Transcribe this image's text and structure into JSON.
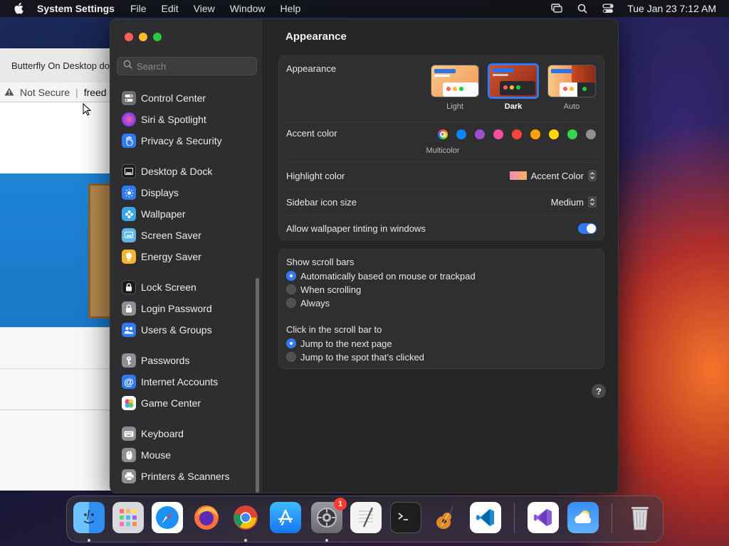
{
  "menubar": {
    "app_name": "System Settings",
    "items": [
      "File",
      "Edit",
      "View",
      "Window",
      "Help"
    ],
    "clock": "Tue Jan 23  7:12 AM"
  },
  "browser": {
    "tab_title": "Butterfly On Desktop do",
    "not_secure": "Not Secure",
    "url": "freed"
  },
  "search": {
    "placeholder": "Search"
  },
  "sidebar": {
    "items": [
      {
        "label": "Control Center",
        "icon": "control-center-icon",
        "color": "#6e6e73"
      },
      {
        "label": "Siri & Spotlight",
        "icon": "siri-icon",
        "color": "#b03de0"
      },
      {
        "label": "Privacy & Security",
        "icon": "hand-icon",
        "color": "#2f7bf5"
      },
      {
        "label": "Desktop & Dock",
        "icon": "dock-icon",
        "color": "#1c1c1e"
      },
      {
        "label": "Displays",
        "icon": "sun-icon",
        "color": "#2f7bf5"
      },
      {
        "label": "Wallpaper",
        "icon": "flower-icon",
        "color": "#38a8e8"
      },
      {
        "label": "Screen Saver",
        "icon": "screen-saver-icon",
        "color": "#5fb8e8"
      },
      {
        "label": "Energy Saver",
        "icon": "bulb-icon",
        "color": "#f5b530"
      },
      {
        "label": "Lock Screen",
        "icon": "lock-icon",
        "color": "#1c1c1e"
      },
      {
        "label": "Login Password",
        "icon": "lock-icon",
        "color": "#8e8e93"
      },
      {
        "label": "Users & Groups",
        "icon": "users-icon",
        "color": "#2f7bf5"
      },
      {
        "label": "Passwords",
        "icon": "key-icon",
        "color": "#8e8e93"
      },
      {
        "label": "Internet Accounts",
        "icon": "at-icon",
        "color": "#2f7bf5"
      },
      {
        "label": "Game Center",
        "icon": "game-center-icon",
        "color": "#ffffff"
      },
      {
        "label": "Keyboard",
        "icon": "keyboard-icon",
        "color": "#8e8e93"
      },
      {
        "label": "Mouse",
        "icon": "mouse-icon",
        "color": "#8e8e93"
      },
      {
        "label": "Printers & Scanners",
        "icon": "printer-icon",
        "color": "#8e8e93"
      }
    ]
  },
  "main": {
    "title": "Appearance",
    "appearance": {
      "label": "Appearance",
      "options": [
        "Light",
        "Dark",
        "Auto"
      ],
      "selected": "Dark"
    },
    "accent": {
      "label": "Accent color",
      "multicolor_label": "Multicolor",
      "colors": [
        "#e0e0e0",
        "#0a84ff",
        "#9b4fd0",
        "#f74f9e",
        "#ff453a",
        "#ff9f0a",
        "#ffd60a",
        "#32d74b",
        "#8e8e93"
      ]
    },
    "highlight": {
      "label": "Highlight color",
      "value": "Accent Color"
    },
    "sidebar_icon_size": {
      "label": "Sidebar icon size",
      "value": "Medium"
    },
    "tinting": {
      "label": "Allow wallpaper tinting in windows",
      "enabled": true
    },
    "scroll_bars": {
      "label": "Show scroll bars",
      "options": [
        "Automatically based on mouse or trackpad",
        "When scrolling",
        "Always"
      ],
      "selected": 0
    },
    "click_scroll": {
      "label": "Click in the scroll bar to",
      "options": [
        "Jump to the next page",
        "Jump to the spot that’s clicked"
      ],
      "selected": 0
    },
    "help": "?"
  },
  "dock": {
    "apps": [
      {
        "name": "Finder",
        "icon": "finder-icon",
        "running": true
      },
      {
        "name": "Launchpad",
        "icon": "launchpad-icon",
        "running": false
      },
      {
        "name": "Safari",
        "icon": "safari-icon",
        "running": false
      },
      {
        "name": "Firefox",
        "icon": "firefox-icon",
        "running": false
      },
      {
        "name": "Chrome",
        "icon": "chrome-icon",
        "running": true
      },
      {
        "name": "App Store",
        "icon": "app-store-icon",
        "running": false
      },
      {
        "name": "System Settings",
        "icon": "system-settings-icon",
        "running": true,
        "badge": "1"
      },
      {
        "name": "TextEdit",
        "icon": "textedit-icon",
        "running": false
      },
      {
        "name": "Terminal",
        "icon": "terminal-icon",
        "running": false
      },
      {
        "name": "GarageBand",
        "icon": "garageband-icon",
        "running": false
      },
      {
        "name": "VS Code",
        "icon": "vscode-icon",
        "running": false
      },
      {
        "name": "Visual Studio",
        "icon": "visual-studio-icon",
        "running": false
      },
      {
        "name": "Weather",
        "icon": "weather-icon",
        "running": false
      },
      {
        "name": "Trash",
        "icon": "trash-icon",
        "running": false
      }
    ]
  }
}
